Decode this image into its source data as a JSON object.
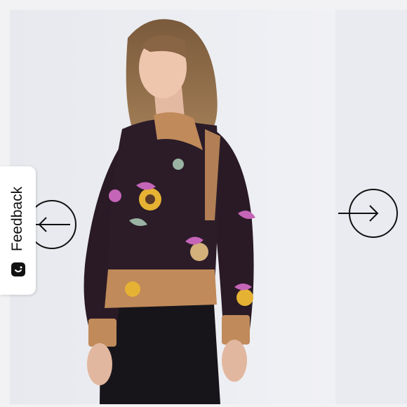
{
  "feedback": {
    "label": "Feedback",
    "icon": "smile-icon"
  },
  "carousel": {
    "prev_icon": "arrow-left-circle-icon",
    "next_icon": "arrow-right-circle-icon"
  },
  "product_image": {
    "subject": "woman-wearing-floral-print-top-icon"
  },
  "colors": {
    "background": "#eceef3",
    "icon_stroke": "#111111",
    "tab_background": "#ffffff"
  }
}
